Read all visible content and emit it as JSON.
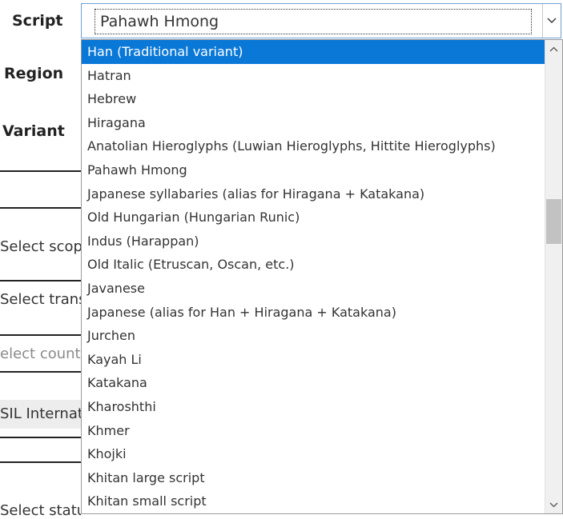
{
  "labels": {
    "script": "Script",
    "region": "Region",
    "variant": "Variant"
  },
  "background_fields": {
    "select_scope": "Select scope",
    "select_translation": "Select transl",
    "select_country": "elect countr",
    "org": "SIL Internat",
    "select_status": "Select status"
  },
  "script_select": {
    "value": "Pahawh Hmong",
    "arrow_icon": "chevron-down-icon"
  },
  "dropdown": {
    "selected_index": 0,
    "options": [
      "Han (Traditional variant)",
      "Hatran",
      "Hebrew",
      "Hiragana",
      "Anatolian Hieroglyphs (Luwian Hieroglyphs, Hittite Hieroglyphs)",
      "Pahawh Hmong",
      "Japanese syllabaries (alias for Hiragana + Katakana)",
      "Old Hungarian (Hungarian Runic)",
      "Indus (Harappan)",
      "Old Italic (Etruscan, Oscan, etc.)",
      "Javanese",
      "Japanese (alias for Han + Hiragana + Katakana)",
      "Jurchen",
      "Kayah Li",
      "Katakana",
      "Kharoshthi",
      "Khmer",
      "Khojki",
      "Khitan large script",
      "Khitan small script"
    ],
    "scroll_position": 0.36
  },
  "colors": {
    "selected_bg": "#0a78d7",
    "focus_border": "#6e9fd6"
  }
}
